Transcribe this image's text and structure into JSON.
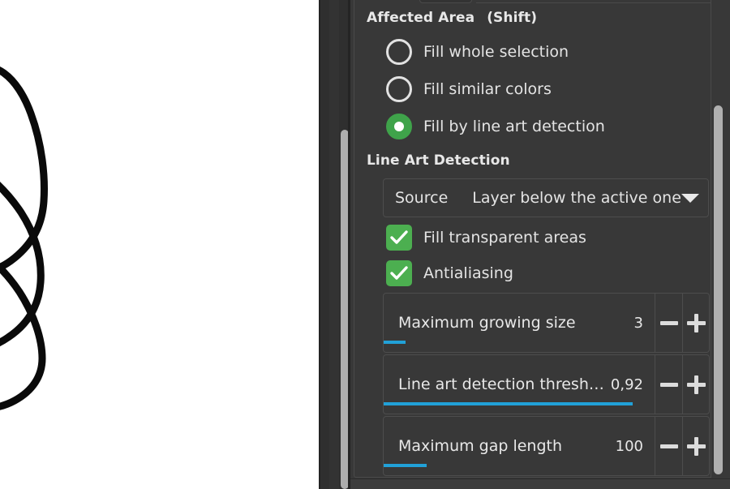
{
  "app": {
    "accent_green": "#4caf50",
    "accent_blue": "#21a1d8",
    "panel_bg": "#383838",
    "text_color": "#e4e4e4"
  },
  "canvas": {
    "name": "line-art-drawing",
    "background": "#ffffff",
    "stroke_color": "#000000"
  },
  "panel": {
    "affected_area": {
      "title": "Affected Area",
      "shortcut_hint": "(Shift)",
      "options": [
        {
          "label": "Fill whole selection",
          "checked": false
        },
        {
          "label": "Fill similar colors",
          "checked": false
        },
        {
          "label": "Fill by line art detection",
          "checked": true
        }
      ]
    },
    "line_art_detection": {
      "title": "Line Art Detection",
      "source": {
        "label": "Source",
        "value": "Layer below the active one",
        "arrow_icon": "chevron-down-icon"
      },
      "checkboxes": [
        {
          "label": "Fill transparent areas",
          "checked": true
        },
        {
          "label": "Antialiasing",
          "checked": true
        }
      ],
      "sliders": [
        {
          "label": "Maximum growing size",
          "value": "3",
          "fill_percent": 8,
          "decrement_label": "−",
          "increment_label": "+"
        },
        {
          "label": "Line art detection thresh…",
          "value": "0,92",
          "fill_percent": 92,
          "decrement_label": "−",
          "increment_label": "+"
        },
        {
          "label": "Maximum gap length",
          "value": "100",
          "fill_percent": 16,
          "decrement_label": "−",
          "increment_label": "+"
        }
      ]
    }
  }
}
